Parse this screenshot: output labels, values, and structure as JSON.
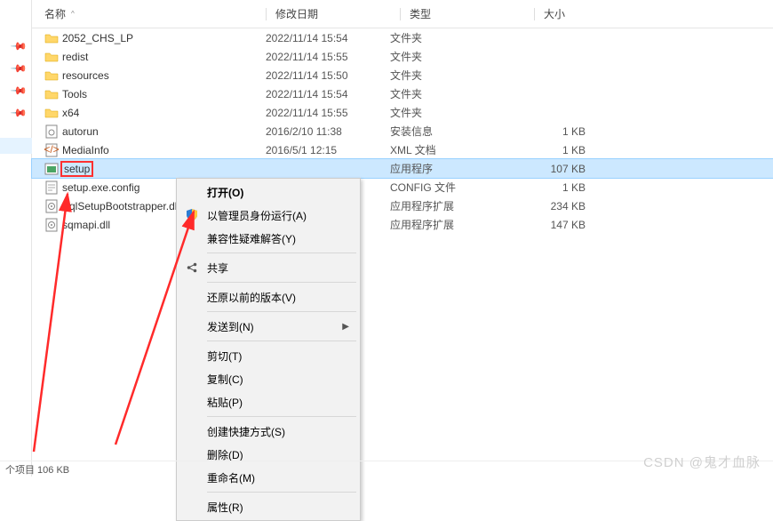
{
  "columns": {
    "name": "名称",
    "date": "修改日期",
    "type": "类型",
    "size": "大小"
  },
  "rows": [
    {
      "kind": "folder",
      "name": "2052_CHS_LP",
      "date": "2022/11/14 15:54",
      "type": "文件夹",
      "size": ""
    },
    {
      "kind": "folder",
      "name": "redist",
      "date": "2022/11/14 15:55",
      "type": "文件夹",
      "size": ""
    },
    {
      "kind": "folder",
      "name": "resources",
      "date": "2022/11/14 15:50",
      "type": "文件夹",
      "size": ""
    },
    {
      "kind": "folder",
      "name": "Tools",
      "date": "2022/11/14 15:54",
      "type": "文件夹",
      "size": ""
    },
    {
      "kind": "folder",
      "name": "x64",
      "date": "2022/11/14 15:55",
      "type": "文件夹",
      "size": ""
    },
    {
      "kind": "inf",
      "name": "autorun",
      "date": "2016/2/10 11:38",
      "type": "安装信息",
      "size": "1 KB"
    },
    {
      "kind": "xml",
      "name": "MediaInfo",
      "date": "2016/5/1 12:15",
      "type": "XML 文档",
      "size": "1 KB"
    },
    {
      "kind": "exe",
      "name": "setup",
      "date": "",
      "type": "应用程序",
      "size": "107 KB",
      "selected": true,
      "highlight": true
    },
    {
      "kind": "cfg",
      "name": "setup.exe.config",
      "date": "",
      "type": "CONFIG 文件",
      "size": "1 KB"
    },
    {
      "kind": "dll",
      "name": "SqlSetupBootstrapper.dll",
      "date": "",
      "type": "应用程序扩展",
      "size": "234 KB"
    },
    {
      "kind": "dll",
      "name": "sqmapi.dll",
      "date": "",
      "type": "应用程序扩展",
      "size": "147 KB"
    }
  ],
  "menu": {
    "open": "打开(O)",
    "run_as_admin": "以管理员身份运行(A)",
    "troubleshoot": "兼容性疑难解答(Y)",
    "share": "共享",
    "restore": "还原以前的版本(V)",
    "send_to": "发送到(N)",
    "cut": "剪切(T)",
    "copy": "复制(C)",
    "paste": "粘贴(P)",
    "shortcut": "创建快捷方式(S)",
    "delete": "删除(D)",
    "rename": "重命名(M)",
    "properties": "属性(R)"
  },
  "status": "个项目  106 KB",
  "watermark": "CSDN @鬼才血脉"
}
